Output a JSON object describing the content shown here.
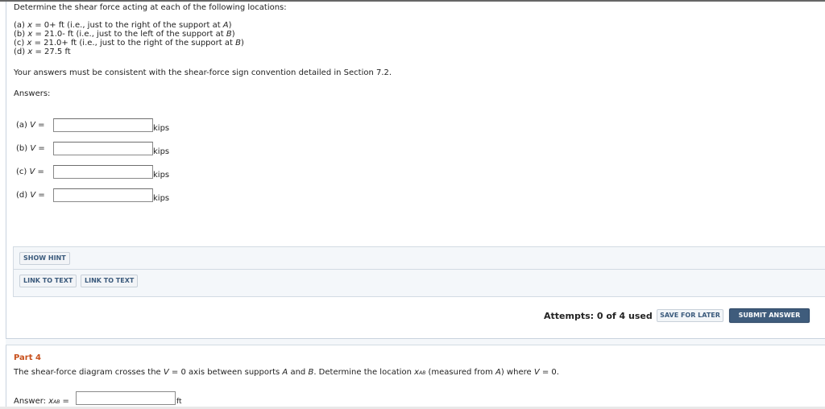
{
  "part3": {
    "intro": "Determine the shear force acting at each of the following locations:",
    "locations": [
      {
        "prefix": "(a) ",
        "var": "x",
        "rest": " = 0+ ft (i.e., just to the right of the support at ",
        "point": "A",
        "close": ")"
      },
      {
        "prefix": "(b) ",
        "var": "x",
        "rest": " = 21.0- ft (i.e., just to the left of the support at ",
        "point": "B",
        "close": ")"
      },
      {
        "prefix": "(c) ",
        "var": "x",
        "rest": " = 21.0+ ft (i.e., just to the right of the support at ",
        "point": "B",
        "close": ")"
      },
      {
        "prefix": "(d) ",
        "var": "x",
        "rest": " = 27.5 ft",
        "point": "",
        "close": ""
      }
    ],
    "convention_note": "Your answers must be consistent with the shear-force sign convention detailed in Section 7.2.",
    "answers_label": "Answers:",
    "answer_rows": [
      {
        "label_prefix": "(a) ",
        "var": "V",
        "eq": " =",
        "value": "",
        "unit": "kips"
      },
      {
        "label_prefix": "(b) ",
        "var": "V",
        "eq": " =",
        "value": "",
        "unit": "kips"
      },
      {
        "label_prefix": "(c) ",
        "var": "V",
        "eq": " =",
        "value": "",
        "unit": "kips"
      },
      {
        "label_prefix": "(d) ",
        "var": "V",
        "eq": " =",
        "value": "",
        "unit": "kips"
      }
    ],
    "hint_button": "SHOW HINT",
    "link_buttons": [
      "LINK TO TEXT",
      "LINK TO TEXT"
    ],
    "attempts": "Attempts: 0 of 4 used",
    "save_button": "SAVE FOR LATER",
    "submit_button": "SUBMIT ANSWER"
  },
  "part4": {
    "title": "Part 4",
    "text_a": "The shear-force diagram crosses the ",
    "text_v": "V",
    "text_b": " = 0 axis between supports ",
    "text_A": "A",
    "text_c": " and ",
    "text_B": "B",
    "text_d": ". Determine the location ",
    "text_x": "x",
    "text_sub": "AB",
    "text_e": " (measured from ",
    "text_A2": "A",
    "text_f": ") where ",
    "text_v2": "V",
    "text_g": " = 0.",
    "answer_label": "Answer: ",
    "answer_var": "x",
    "answer_sub": "AB",
    "answer_eq": " =",
    "answer_value": "",
    "answer_unit": "ft"
  },
  "colors": {
    "part_title": "#c8501c",
    "submit_bg": "#3f5c7c",
    "button_text": "#3a5a7c",
    "panel_bg": "#f4f7fa"
  }
}
